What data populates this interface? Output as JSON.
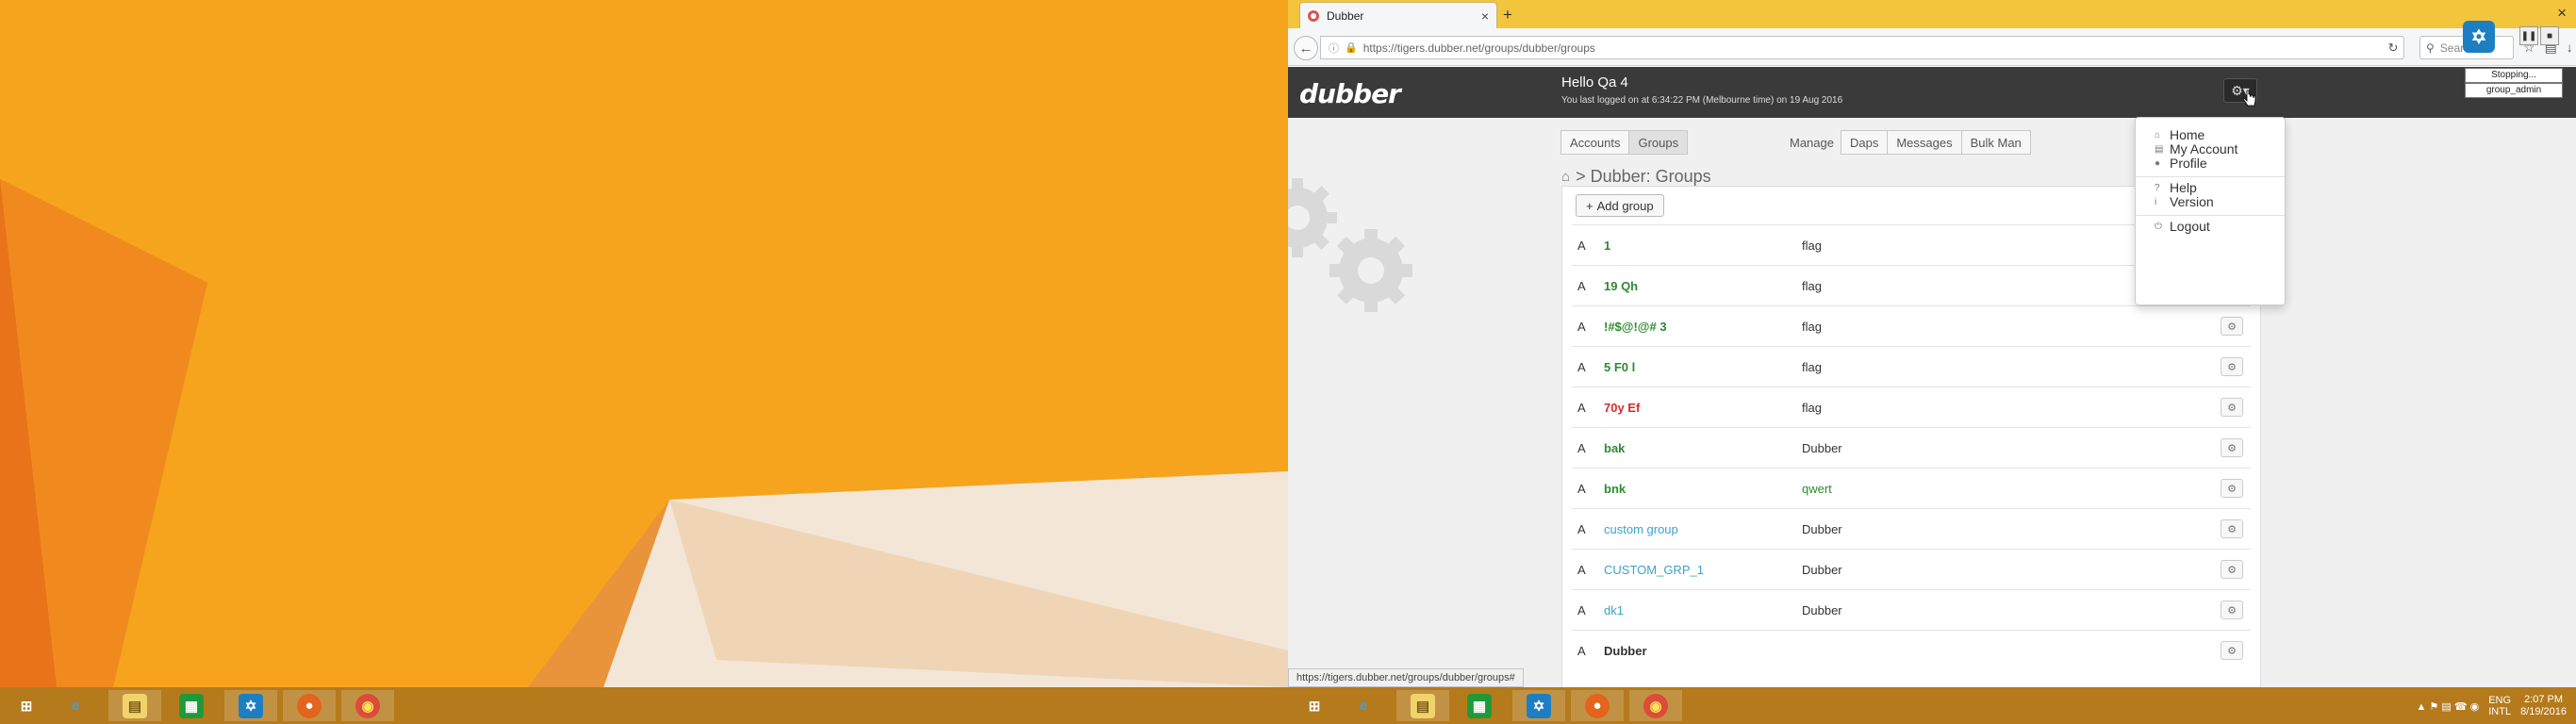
{
  "browser": {
    "tab_title": "Dubber",
    "new_tab_symbol": "+",
    "close_symbol": "×",
    "url": "https://tigers.dubber.net/groups/dubber/groups",
    "search_placeholder": "Search",
    "status_url": "https://tigers.dubber.net/groups/dubber/groups#"
  },
  "header": {
    "logo": "dubber",
    "greeting": "Hello Qa 4",
    "last_login": "You last logged on at 6:34:22 PM (Melbourne time) on 19 Aug 2016"
  },
  "nav": {
    "tabs": [
      "Accounts",
      "Groups"
    ],
    "active_tab": "Groups",
    "manage_label": "Manage",
    "manage_items": [
      "Daps",
      "Messages",
      "Bulk Man"
    ]
  },
  "breadcrumb": "> Dubber: Groups",
  "add_group_label": "Add group",
  "groups": [
    {
      "a": "A",
      "name": "1",
      "tag": "flag",
      "name_color": "#2e8b2e",
      "tag_green": false
    },
    {
      "a": "A",
      "name": "19 Qh",
      "tag": "flag",
      "name_color": "#2e8b2e",
      "tag_green": false
    },
    {
      "a": "A",
      "name": "!#$@!@# 3",
      "tag": "flag",
      "name_color": "#2e8b2e",
      "tag_green": false
    },
    {
      "a": "A",
      "name": "5 F0 l",
      "tag": "flag",
      "name_color": "#2e8b2e",
      "tag_green": false
    },
    {
      "a": "A",
      "name": "70y Ef",
      "tag": "flag",
      "name_color": "#d62b2b",
      "tag_green": false
    },
    {
      "a": "A",
      "name": "bak",
      "tag": "Dubber",
      "name_color": "#2e8b2e",
      "tag_green": false
    },
    {
      "a": "A",
      "name": "bnk",
      "tag": "qwert",
      "name_color": "#2e8b2e",
      "tag_green": true
    },
    {
      "a": "A",
      "name": "custom group",
      "tag": "Dubber",
      "name_color": "#3aa3c9",
      "tag_green": false
    },
    {
      "a": "A",
      "name": "CUSTOM_GRP_1",
      "tag": "Dubber",
      "name_color": "#3aa3c9",
      "tag_green": false
    },
    {
      "a": "A",
      "name": "dk1",
      "tag": "Dubber",
      "name_color": "#3aa3c9",
      "tag_green": false
    },
    {
      "a": "A",
      "name": "Dubber",
      "tag": "",
      "name_color": "#333333",
      "tag_green": false
    }
  ],
  "user_menu": {
    "items": [
      "Home",
      "My Account",
      "Profile",
      "Help",
      "Version",
      "Logout"
    ],
    "icons": [
      "home-icon",
      "account-icon",
      "user-icon",
      "help-icon",
      "info-icon",
      "power-icon"
    ]
  },
  "recorder": {
    "status": "Stopping...",
    "user": "group_admin"
  },
  "taskbar": {
    "lang_top": "ENG",
    "lang_bottom": "INTL",
    "time": "2:07 PM",
    "date": "8/19/2016"
  },
  "colors": {
    "desktop": "#f5a623",
    "taskbar": "#b57a1b",
    "header": "#3a3a3a",
    "tabbar": "#f3c53c"
  }
}
